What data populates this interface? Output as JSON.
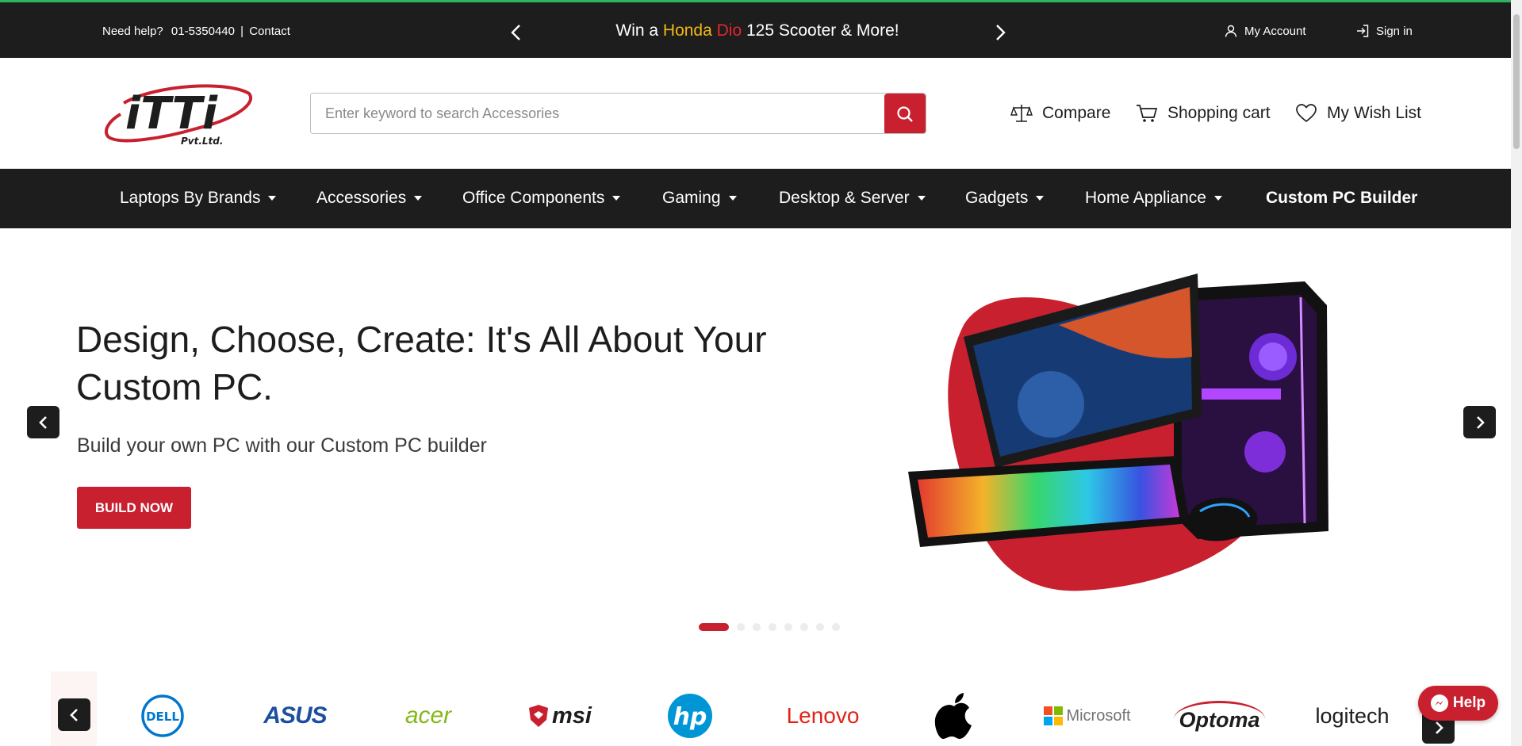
{
  "topbar": {
    "help_label": "Need help?",
    "phone": "01-5350440",
    "separator": "|",
    "contact": "Contact",
    "promo": {
      "prefix": "Win a ",
      "honda": "Honda",
      "dio": " Dio",
      "suffix": " 125 Scooter & More!"
    },
    "my_account": "My Account",
    "sign_in": "Sign in",
    "accent_green": "#2fb35c"
  },
  "header": {
    "logo_text": "iTTi",
    "logo_sub": "Pvt.Ltd.",
    "search_placeholder": "Enter keyword to search Accessories",
    "compare": "Compare",
    "cart": "Shopping cart",
    "wishlist": "My Wish List"
  },
  "nav": {
    "items": [
      {
        "label": "Laptops By Brands"
      },
      {
        "label": "Accessories"
      },
      {
        "label": "Office Components"
      },
      {
        "label": "Gaming"
      },
      {
        "label": "Desktop & Server"
      },
      {
        "label": "Gadgets"
      },
      {
        "label": "Home Appliance"
      },
      {
        "label": "Custom PC Builder"
      }
    ]
  },
  "hero": {
    "title": "Design, Choose, Create: It's All About Your Custom PC.",
    "subtitle": "Build your own PC with our Custom PC builder",
    "button": "BUILD NOW",
    "slide_count": 8,
    "active_slide": 1
  },
  "brands": {
    "items": [
      "DELL",
      "ASUS",
      "acer",
      "msi",
      "hp",
      "Lenovo",
      "Apple",
      "Microsoft",
      "Optoma",
      "logitech"
    ]
  },
  "help_button": "Help",
  "colors": {
    "brand_red": "#c8202f",
    "dark": "#1d1d1d"
  }
}
